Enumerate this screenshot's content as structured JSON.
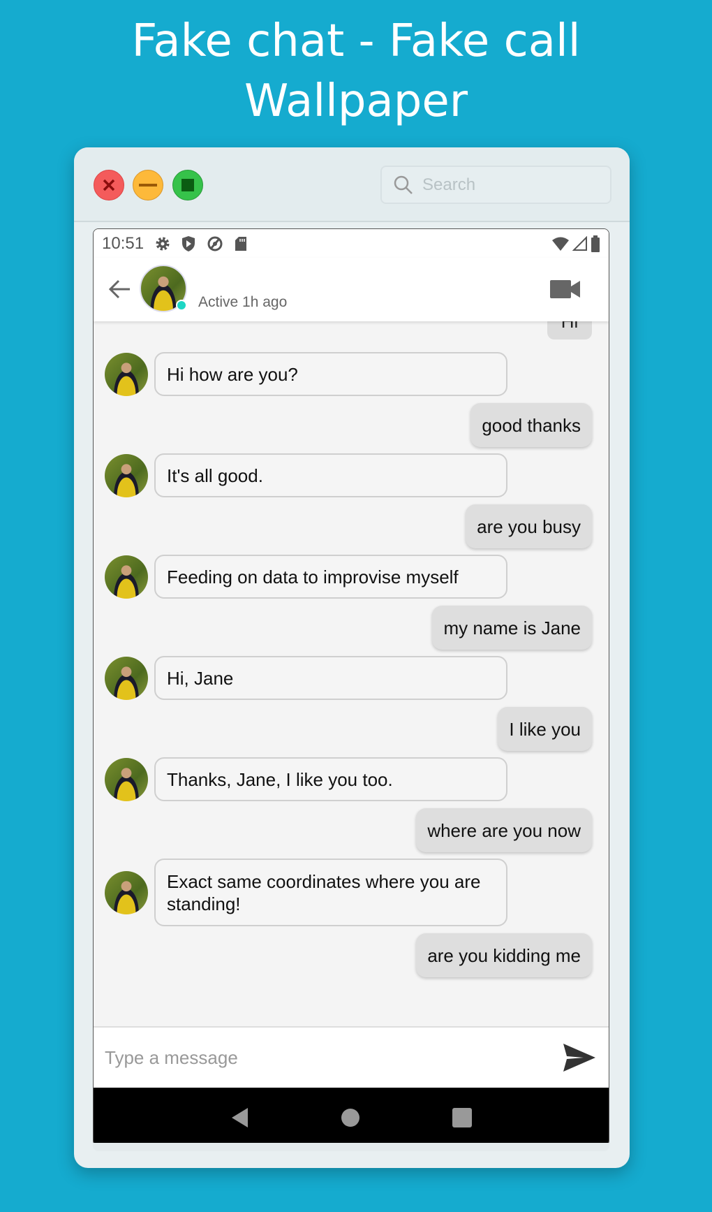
{
  "banner": {
    "line1": "Fake chat - Fake call",
    "line2": "Wallpaper"
  },
  "window": {
    "search_placeholder": "Search",
    "icons": [
      "close-icon",
      "minimize-icon",
      "maximize-icon"
    ]
  },
  "status_bar": {
    "time": "10:51",
    "icons": [
      "gear-icon",
      "shield-play-icon",
      "location-off-icon",
      "sd-card-icon",
      "wifi-icon",
      "signal-icon",
      "battery-icon"
    ]
  },
  "header": {
    "status": "Active 1h ago",
    "online_color": "#1dd6c4"
  },
  "chat": {
    "partial_top": "Hi",
    "messages": [
      {
        "side": "left",
        "text": "Hi how are you?"
      },
      {
        "side": "right",
        "text": "good thanks"
      },
      {
        "side": "left",
        "text": "It's all good."
      },
      {
        "side": "right",
        "text": "are you busy"
      },
      {
        "side": "left",
        "text": "Feeding on data to improvise myself"
      },
      {
        "side": "right",
        "text": "my name is Jane"
      },
      {
        "side": "left",
        "text": "Hi, Jane"
      },
      {
        "side": "right",
        "text": "I like you"
      },
      {
        "side": "left",
        "text": "Thanks, Jane, I like you too."
      },
      {
        "side": "right",
        "text": "where are you now"
      },
      {
        "side": "left",
        "text": "Exact same coordinates where you are standing!"
      },
      {
        "side": "right",
        "text": "are you kidding me"
      }
    ]
  },
  "composer": {
    "placeholder": "Type a message"
  },
  "colors": {
    "background": "#15abcf",
    "incoming_bubble": "#f5f5f5",
    "outgoing_bubble": "#dedede"
  }
}
